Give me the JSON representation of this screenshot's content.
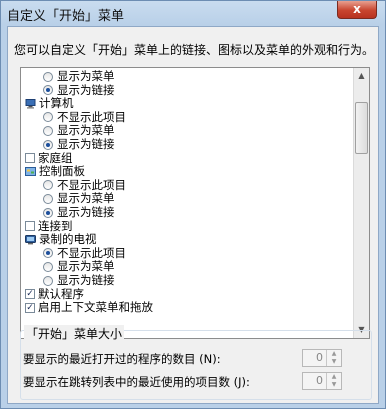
{
  "window": {
    "title": "自定义「开始」菜单",
    "close_label": "x"
  },
  "description": "您可以自定义「开始」菜单上的链接、图标以及菜单的外观和行为。",
  "list": [
    {
      "type": "radio",
      "label": "显示为菜单",
      "selected": false
    },
    {
      "type": "radio",
      "label": "显示为链接",
      "selected": true
    },
    {
      "type": "item",
      "icon": "computer-icon",
      "label": "计算机"
    },
    {
      "type": "radio",
      "label": "不显示此项目",
      "selected": false
    },
    {
      "type": "radio",
      "label": "显示为菜单",
      "selected": false
    },
    {
      "type": "radio",
      "label": "显示为链接",
      "selected": true
    },
    {
      "type": "checkbox",
      "label": "家庭组",
      "checked": false
    },
    {
      "type": "item",
      "icon": "control-panel-icon",
      "label": "控制面板"
    },
    {
      "type": "radio",
      "label": "不显示此项目",
      "selected": false
    },
    {
      "type": "radio",
      "label": "显示为菜单",
      "selected": false
    },
    {
      "type": "radio",
      "label": "显示为链接",
      "selected": true
    },
    {
      "type": "checkbox",
      "label": "连接到",
      "checked": false
    },
    {
      "type": "item",
      "icon": "tv-icon",
      "label": "录制的电视"
    },
    {
      "type": "radio",
      "label": "不显示此项目",
      "selected": true
    },
    {
      "type": "radio",
      "label": "显示为菜单",
      "selected": false
    },
    {
      "type": "radio",
      "label": "显示为链接",
      "selected": false
    },
    {
      "type": "checkbox",
      "label": "默认程序",
      "checked": true
    },
    {
      "type": "checkbox",
      "label": "启用上下文菜单和拖放",
      "checked": true
    }
  ],
  "size_group": {
    "title": "「开始」菜单大小",
    "recent_programs_label": "要显示的最近打开过的程序的数目 (N):",
    "recent_programs_value": "0",
    "jumplist_label": "要显示在跳转列表中的最近使用的项目数 (J):",
    "jumplist_value": "0"
  },
  "colors": {
    "title_bg": "#c9dcef",
    "client_bg": "#f0f0f0",
    "close_red": "#c8452f",
    "radio_dot": "#1c4f9c"
  }
}
